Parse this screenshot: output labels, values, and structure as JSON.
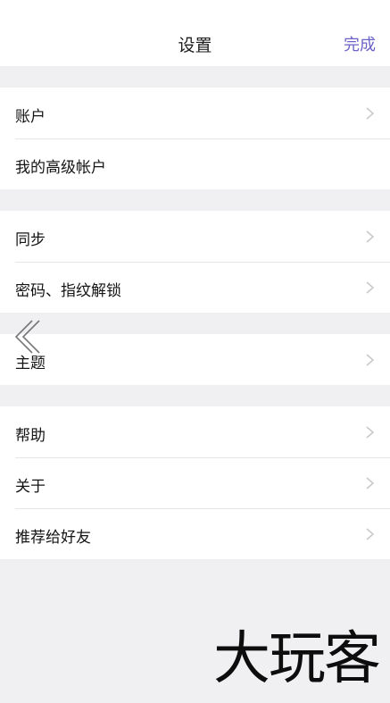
{
  "header": {
    "title": "设置",
    "done_label": "完成"
  },
  "groups": [
    {
      "items": [
        {
          "label": "账户",
          "chevron": true
        },
        {
          "label": "我的高级帐户",
          "chevron": false
        }
      ]
    },
    {
      "items": [
        {
          "label": "同步",
          "chevron": true
        },
        {
          "label": "密码、指纹解锁",
          "chevron": true
        }
      ]
    },
    {
      "items": [
        {
          "label": "主题",
          "chevron": true
        }
      ]
    },
    {
      "items": [
        {
          "label": "帮助",
          "chevron": true
        },
        {
          "label": "关于",
          "chevron": true
        },
        {
          "label": "推荐给好友",
          "chevron": true
        }
      ]
    }
  ],
  "watermark": "大玩客",
  "icons": {
    "chevron": "chevron-right-icon",
    "back_gesture": "back-gesture-icon"
  },
  "colors": {
    "accent": "#6b63c8",
    "background": "#f0f0f2",
    "cell": "#ffffff",
    "separator": "#e6e6ea",
    "chevron": "#c7c7cc"
  }
}
